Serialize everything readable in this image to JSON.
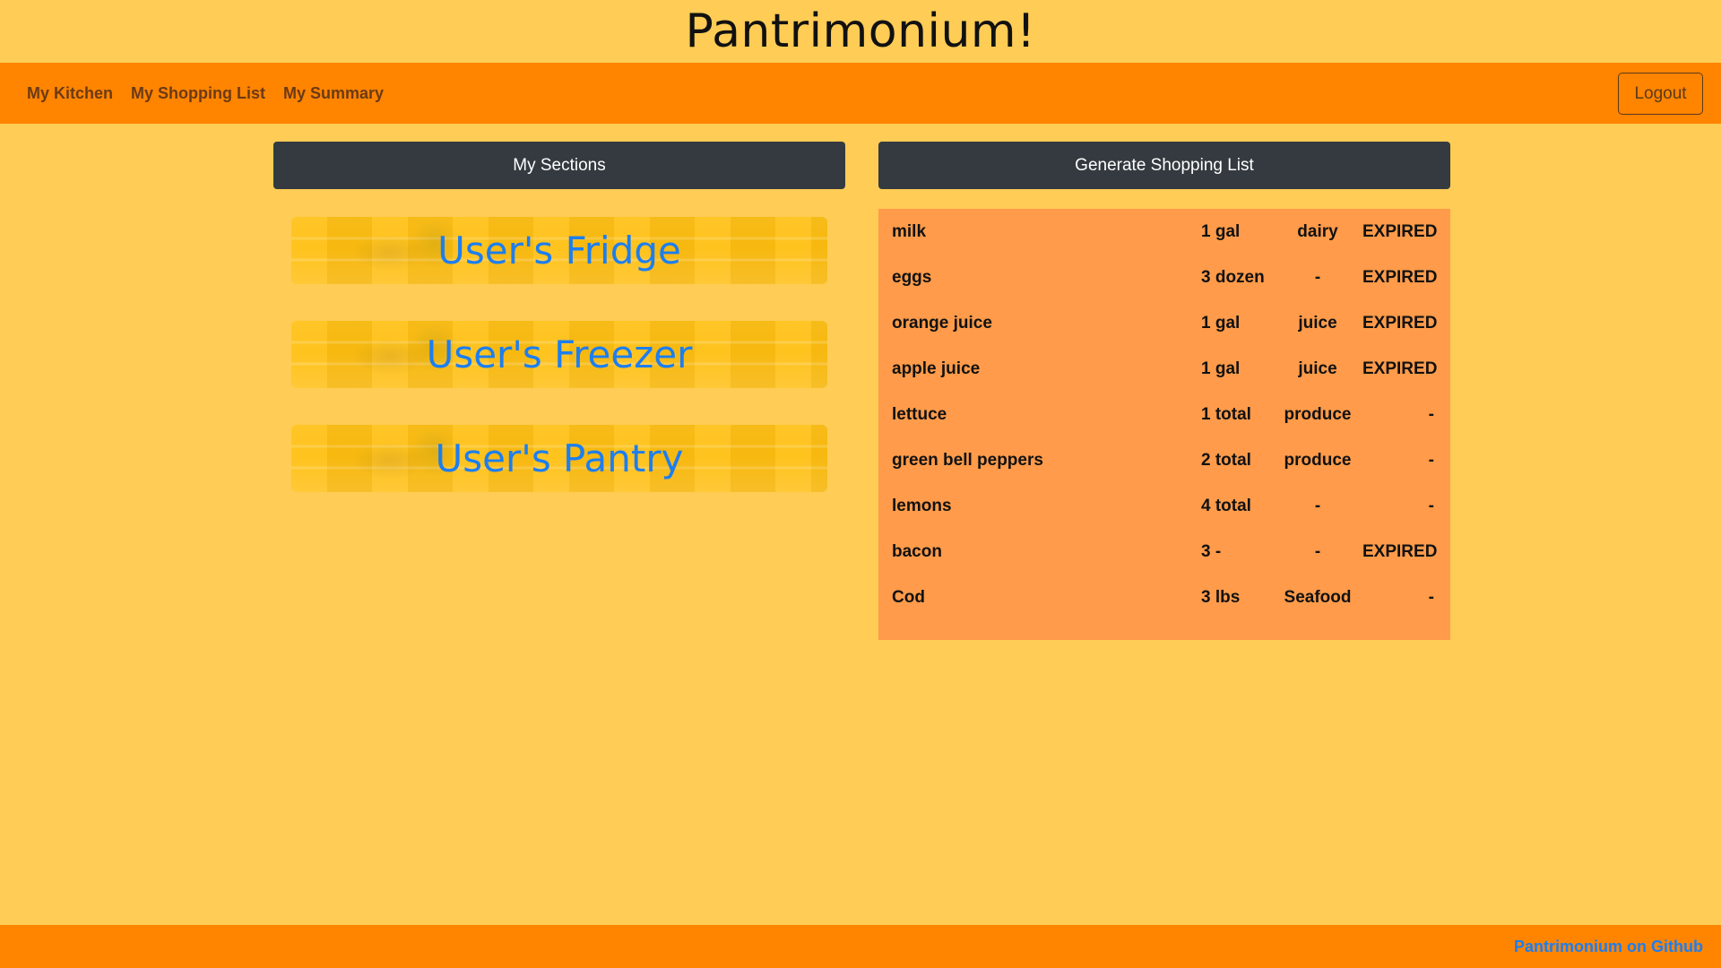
{
  "site": {
    "title": "Pantrimonium!"
  },
  "nav": {
    "links": [
      "My Kitchen",
      "My Shopping List",
      "My Summary"
    ],
    "logout_label": "Logout"
  },
  "sections": {
    "header": "My Sections",
    "items": [
      "User's Fridge",
      "User's Freezer",
      "User's Pantry"
    ]
  },
  "shopping": {
    "header": "Generate Shopping List",
    "rows": [
      {
        "name": "milk",
        "qty": "1 gal",
        "category": "dairy",
        "status": "EXPIRED"
      },
      {
        "name": "eggs",
        "qty": "3 dozen",
        "category": "-",
        "status": "EXPIRED"
      },
      {
        "name": "orange juice",
        "qty": "1 gal",
        "category": "juice",
        "status": "EXPIRED"
      },
      {
        "name": "apple juice",
        "qty": "1 gal",
        "category": "juice",
        "status": "EXPIRED"
      },
      {
        "name": "lettuce",
        "qty": "1 total",
        "category": "produce",
        "status": "-"
      },
      {
        "name": "green bell peppers",
        "qty": "2 total",
        "category": "produce",
        "status": "-"
      },
      {
        "name": "lemons",
        "qty": "4 total",
        "category": "-",
        "status": "-"
      },
      {
        "name": "bacon",
        "qty": "3 -",
        "category": "-",
        "status": "EXPIRED"
      },
      {
        "name": "Cod",
        "qty": "3 lbs",
        "category": "Seafood",
        "status": "-"
      }
    ]
  },
  "footer": {
    "link_label": "Pantrimonium on Github"
  },
  "colors": {
    "background": "#ffcc55",
    "navbar": "#ff8400",
    "header_button": "#343a40",
    "list_background": "#ff9b4a",
    "link": "#1c7ef0"
  }
}
